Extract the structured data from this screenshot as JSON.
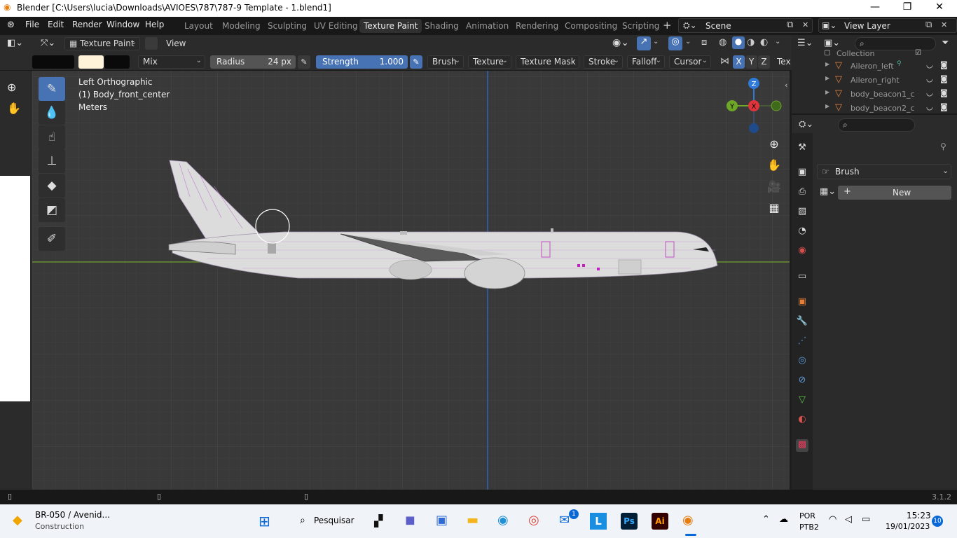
{
  "window": {
    "title": "Blender [C:\\Users\\lucia\\Downloads\\AVIOES\\787\\787-9 Template - 1.blend1]",
    "min": "—",
    "max": "❐",
    "close": "✕"
  },
  "menu": [
    "File",
    "Edit",
    "Render",
    "Window",
    "Help"
  ],
  "workspaces": [
    "Layout",
    "Modeling",
    "Sculpting",
    "UV Editing",
    "Texture Paint",
    "Shading",
    "Animation",
    "Rendering",
    "Compositing",
    "Scripting"
  ],
  "active_workspace": "Texture Paint",
  "scene": {
    "name": "Scene",
    "view_layer": "View Layer"
  },
  "header": {
    "mode": "Texture Paint",
    "view": "View"
  },
  "tool_settings": {
    "blend": "Mix",
    "radius_label": "Radius",
    "radius_value": "24 px",
    "strength_label": "Strength",
    "strength_value": "1.000",
    "menus": [
      "Brush",
      "Texture",
      "Texture Mask",
      "Stroke",
      "Falloff",
      "Cursor"
    ],
    "axes": [
      "X",
      "Y",
      "Z"
    ],
    "tex_label": "Tex",
    "primary_color": "#fff3d9",
    "secondary_color": "#0a0a0a"
  },
  "viewport": {
    "view_name": "Left Orthographic",
    "object_name": "(1) Body_front_center",
    "units": "Meters",
    "gizmo": {
      "z": "Z",
      "y": "Y",
      "x": "X"
    }
  },
  "outliner": {
    "collection": "Collection",
    "items": [
      "Aileron_left",
      "Aileron_right",
      "body_beacon1_c",
      "body_beacon2_c"
    ]
  },
  "properties": {
    "panel_title": "Brush",
    "new_button": "New"
  },
  "status": {
    "version": "3.1.2"
  },
  "taskbar": {
    "weather_title": "BR-050 / Avenid...",
    "weather_sub": "Construction",
    "search": "Pesquisar",
    "lang": "POR",
    "layout": "PTB2",
    "time": "15:23",
    "date": "19/01/2023",
    "notif_count": "10",
    "mail_badge": "1"
  },
  "colors": {
    "accent": "#4772b3",
    "x_axis": "#e0343c",
    "y_axis": "#6ea628",
    "z_axis": "#2f7ad9"
  }
}
